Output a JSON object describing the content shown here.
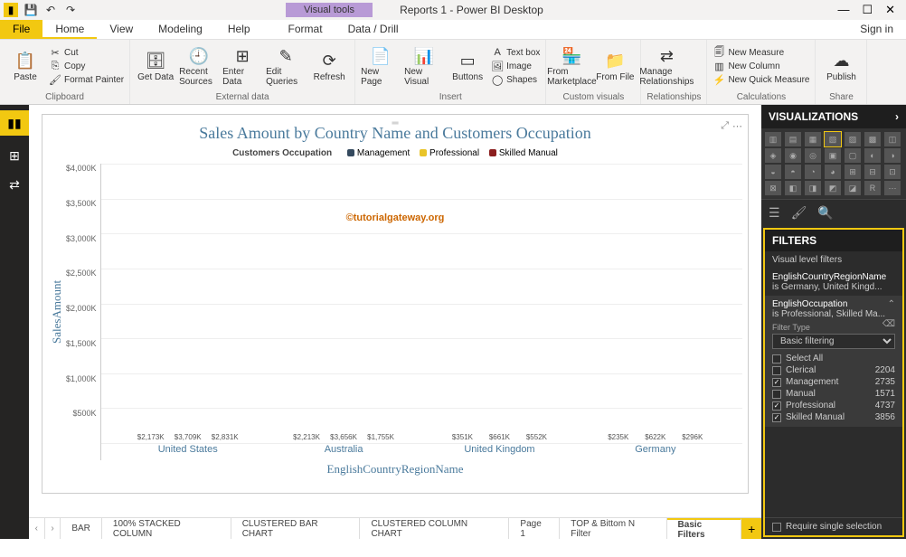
{
  "app": {
    "title": "Reports 1 - Power BI Desktop",
    "visual_tools": "Visual tools",
    "signin": "Sign in"
  },
  "tabs": {
    "file": "File",
    "home": "Home",
    "view": "View",
    "modeling": "Modeling",
    "help": "Help",
    "format": "Format",
    "datadrill": "Data / Drill"
  },
  "ribbon": {
    "clipboard": {
      "label": "Clipboard",
      "paste": "Paste",
      "cut": "Cut",
      "copy": "Copy",
      "format_painter": "Format Painter"
    },
    "external": {
      "label": "External data",
      "get_data": "Get Data",
      "recent_sources": "Recent Sources",
      "enter_data": "Enter Data",
      "edit_queries": "Edit Queries",
      "refresh": "Refresh"
    },
    "insert": {
      "label": "Insert",
      "new_page": "New Page",
      "new_visual": "New Visual",
      "buttons": "Buttons",
      "textbox": "Text box",
      "image": "Image",
      "shapes": "Shapes"
    },
    "custom": {
      "label": "Custom visuals",
      "from_marketplace": "From Marketplace",
      "from_file": "From File"
    },
    "relationships": {
      "label": "Relationships",
      "manage": "Manage Relationships"
    },
    "calculations": {
      "label": "Calculations",
      "new_measure": "New Measure",
      "new_column": "New Column",
      "new_quick": "New Quick Measure"
    },
    "share": {
      "label": "Share",
      "publish": "Publish"
    }
  },
  "chart_data": {
    "type": "bar",
    "title": "Sales Amount by Country Name and Customers Occupation",
    "legend_title": "Customers Occupation",
    "xlabel": "EnglishCountryRegionName",
    "ylabel": "SalesAmount",
    "ylim": [
      0,
      4000
    ],
    "y_ticks": [
      "$4,000K",
      "$3,500K",
      "$3,000K",
      "$2,500K",
      "$2,000K",
      "$1,500K",
      "$1,000K",
      "$500K",
      ""
    ],
    "categories": [
      "United States",
      "Australia",
      "United Kingdom",
      "Germany"
    ],
    "series": [
      {
        "name": "Management",
        "color": "#34495e",
        "values": [
          2173,
          2213,
          351,
          235
        ],
        "labels": [
          "$2,173K",
          "$2,213K",
          "$351K",
          "$235K"
        ]
      },
      {
        "name": "Professional",
        "color": "#e9c429",
        "values": [
          3709,
          3656,
          661,
          622
        ],
        "labels": [
          "$3,709K",
          "$3,656K",
          "$661K",
          "$622K"
        ]
      },
      {
        "name": "Skilled Manual",
        "color": "#8b1e1e",
        "values": [
          2831,
          1755,
          552,
          296
        ],
        "labels": [
          "$2,831K",
          "$1,755K",
          "$552K",
          "$296K"
        ]
      }
    ],
    "watermark": "©tutorialgateway.org"
  },
  "page_tabs": [
    "BAR",
    "100% STACKED COLUMN",
    "CLUSTERED BAR CHART",
    "CLUSTERED COLUMN CHART",
    "Page 1",
    "TOP & Bittom N Filter",
    "Basic Filters"
  ],
  "right": {
    "viz_header": "VISUALIZATIONS",
    "filters_header": "FILTERS",
    "vlf_label": "Visual level filters",
    "filter1": {
      "name": "EnglishCountryRegionName",
      "subtitle": "is Germany, United Kingd..."
    },
    "filter2": {
      "name": "EnglishOccupation",
      "subtitle": "is Professional, Skilled Ma...",
      "type_label": "Filter Type",
      "type_value": "Basic filtering",
      "items": [
        {
          "label": "Select All",
          "count": "",
          "checked": false
        },
        {
          "label": "Clerical",
          "count": "2204",
          "checked": false
        },
        {
          "label": "Management",
          "count": "2735",
          "checked": true
        },
        {
          "label": "Manual",
          "count": "1571",
          "checked": false
        },
        {
          "label": "Professional",
          "count": "4737",
          "checked": true
        },
        {
          "label": "Skilled Manual",
          "count": "3856",
          "checked": true
        }
      ]
    },
    "require_single": "Require single selection"
  }
}
